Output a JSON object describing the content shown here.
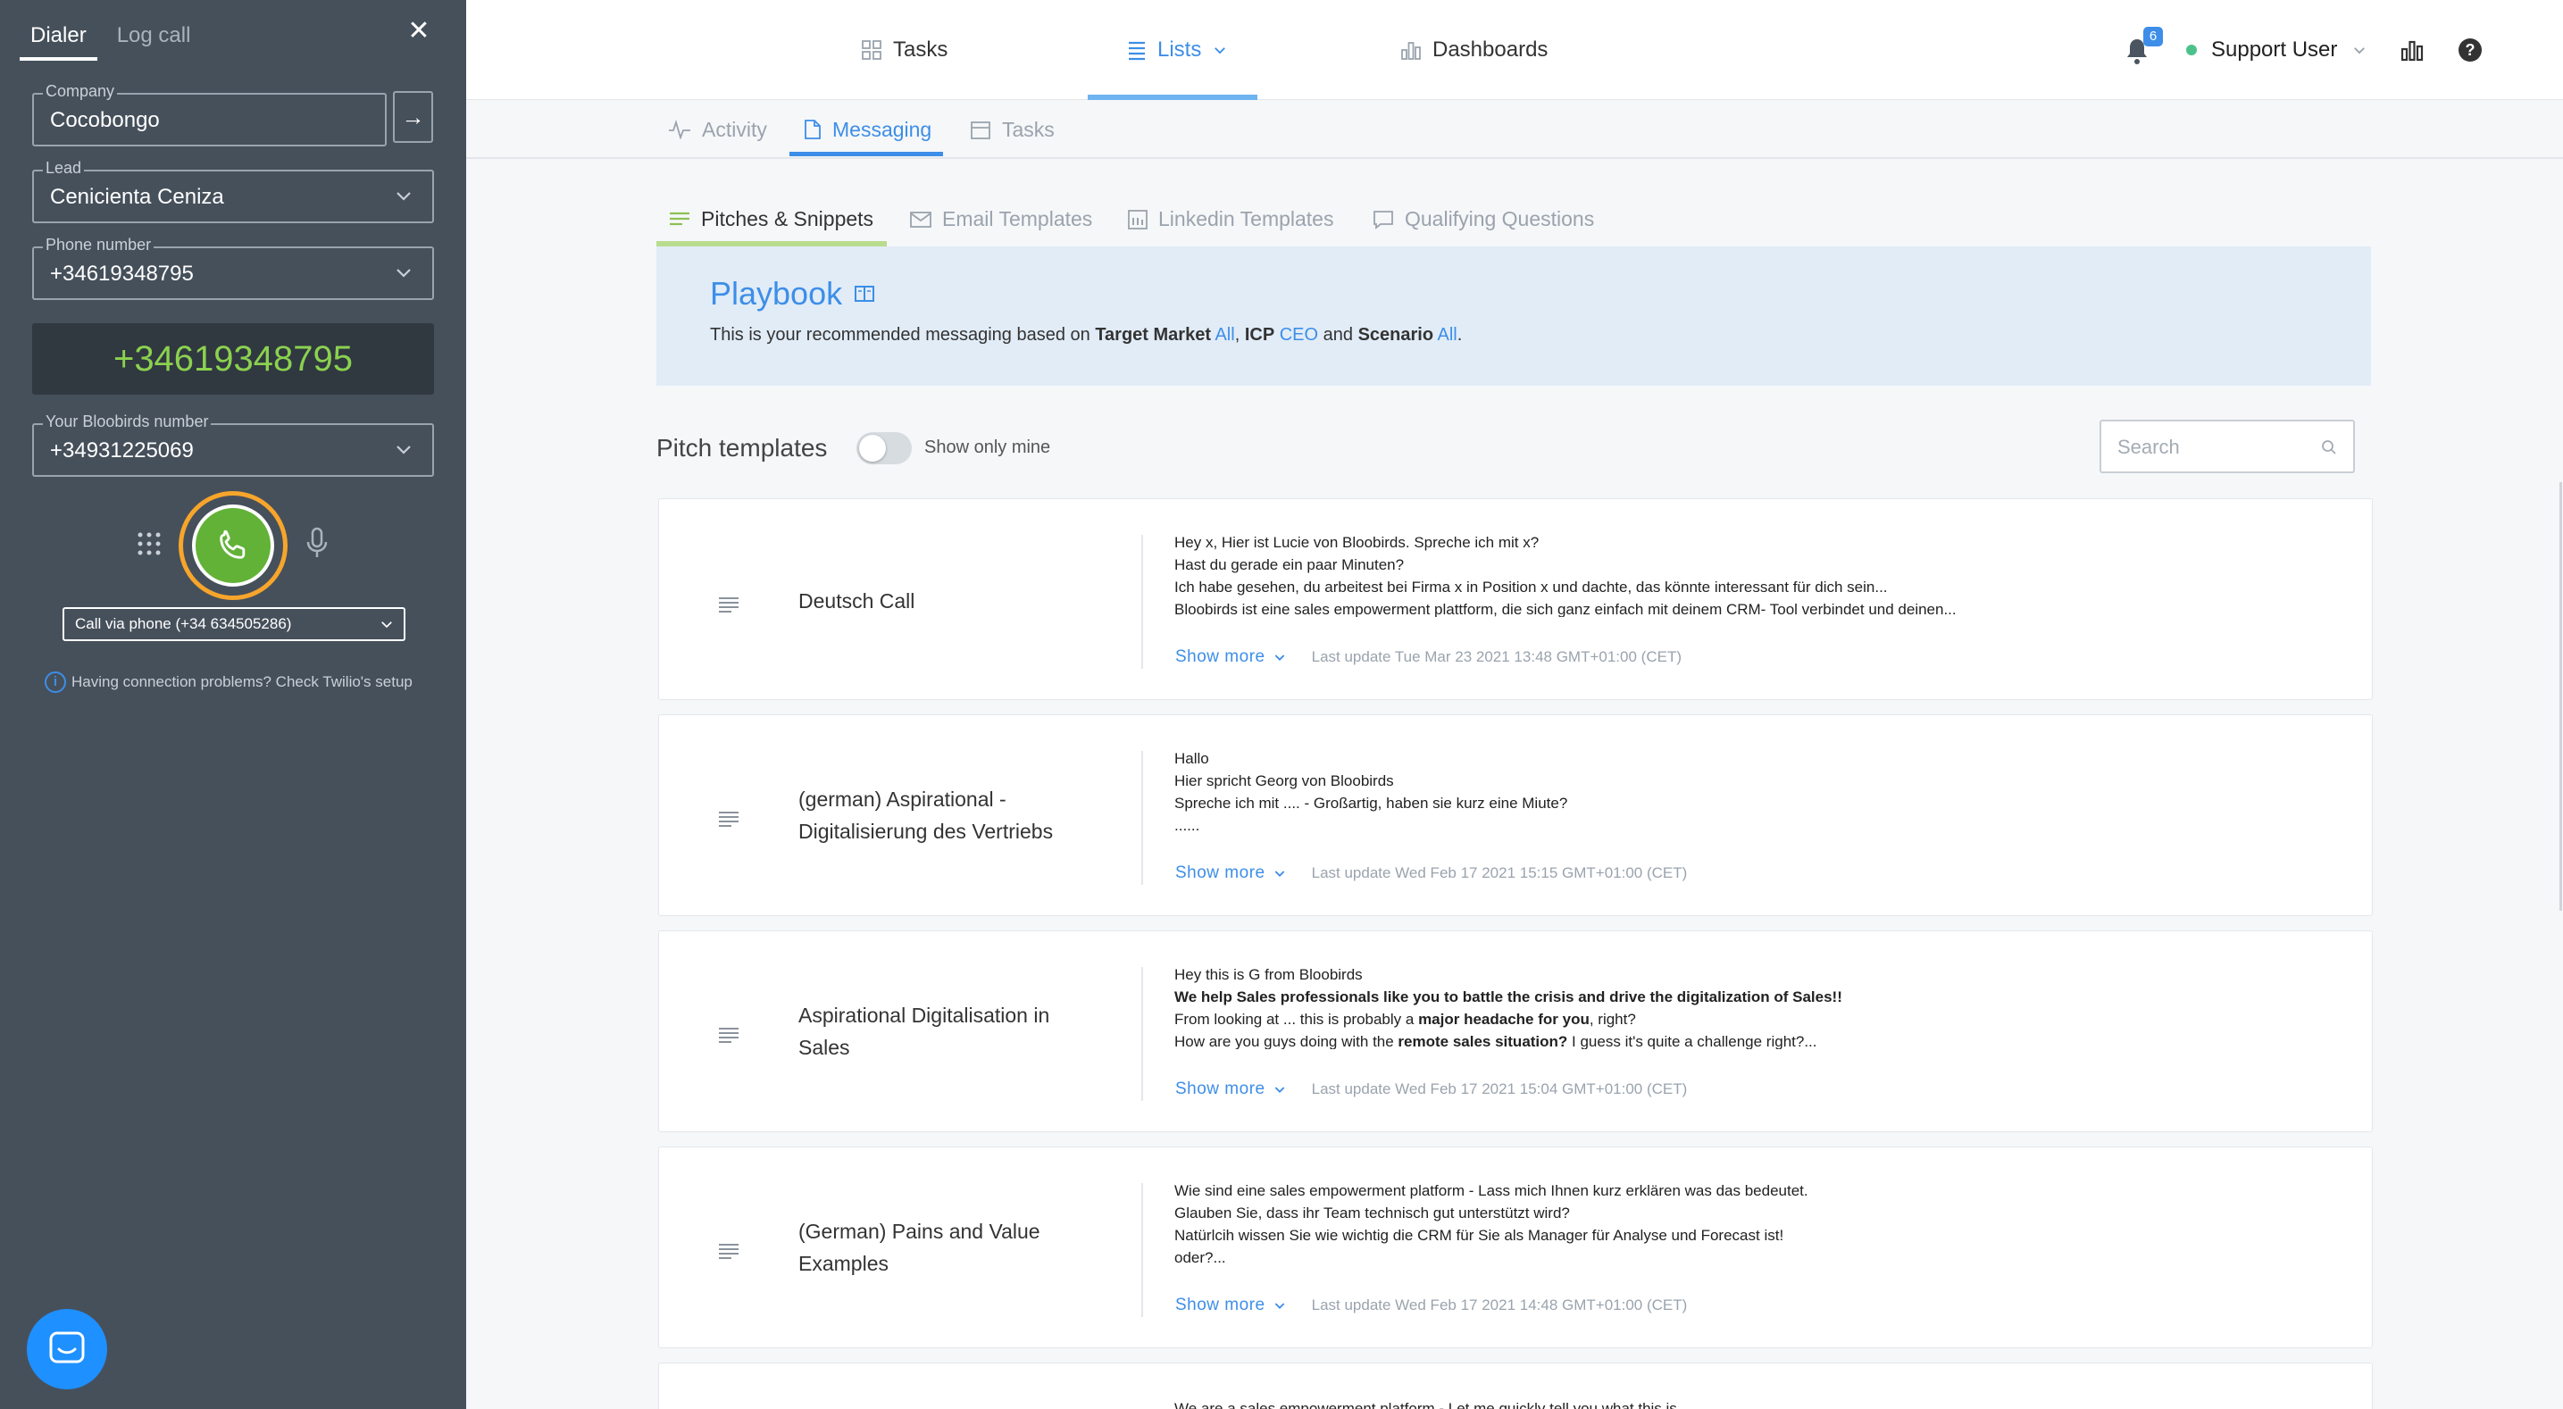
{
  "dialer": {
    "tabs": [
      "Dialer",
      "Log call"
    ],
    "company": {
      "label": "Company",
      "value": "Cocobongo"
    },
    "lead": {
      "label": "Lead",
      "value": "Cenicienta Ceniza"
    },
    "phone": {
      "label": "Phone number",
      "value": "+34619348795"
    },
    "display_number": "+34619348795",
    "bloobirds_number": {
      "label": "Your Bloobirds number",
      "value": "+34931225069"
    },
    "call_via": "Call via phone (+34 634505286)",
    "connection_problems": "Having connection problems? Check Twilio's setup"
  },
  "topnav": {
    "tasks": "Tasks",
    "lists": "Lists",
    "dashboards": "Dashboards",
    "notifications_count": "6",
    "user": "Support User"
  },
  "subnav": {
    "activity": "Activity",
    "messaging": "Messaging",
    "tasks": "Tasks"
  },
  "content_tabs": [
    "Pitches & Snippets",
    "Email Templates",
    "Linkedin Templates",
    "Qualifying Questions"
  ],
  "playbook": {
    "title": "Playbook",
    "desc_prefix": "This is your recommended messaging based on ",
    "target_market_label": "Target Market",
    "target_market_value": "All",
    "icp_label": "ICP",
    "icp_value": "CEO",
    "and_word": "and",
    "scenario_label": "Scenario",
    "scenario_value": "All"
  },
  "pitch": {
    "title": "Pitch templates",
    "show_only_mine": "Show only mine",
    "search_placeholder": "Search"
  },
  "cards": [
    {
      "name": "Deutsch Call",
      "lines": [
        "Hey x,  Hier ist Lucie von Bloobirds. Spreche ich mit x?",
        "Hast du gerade ein paar Minuten?",
        "Ich habe gesehen, du arbeitest bei Firma x in Position x und dachte, das könnte interessant für dich sein...",
        "Bloobirds ist eine sales empowerment plattform, die sich ganz einfach mit deinem CRM- Tool verbindet und deinen..."
      ],
      "show_more": "Show more",
      "last_update": "Last update Tue Mar 23 2021 13:48 GMT+01:00 (CET)"
    },
    {
      "name": "(german) Aspirational - Digitalisierung des Vertriebs",
      "lines": [
        "Hallo",
        "Hier spricht Georg von Bloobirds",
        "Spreche ich mit .... - Großartig, haben sie kurz eine Miute?",
        "......"
      ],
      "show_more": "Show more",
      "last_update": "Last update Wed Feb 17 2021 15:15 GMT+01:00 (CET)"
    },
    {
      "name": "Aspirational Digitalisation in Sales",
      "line1": "Hey this is G from Bloobirds",
      "line2": "We help Sales professionals like you to battle the crisis and drive the digitalization of Sales!!",
      "line3_a": "From looking at ... this is probably a ",
      "line3_b": "major headache for you",
      "line3_c": ", right?",
      "line4_a": "How are you guys doing with the ",
      "line4_b": "remote sales situation?",
      "line4_c": " I guess it's quite a challenge right?...",
      "show_more": "Show more",
      "last_update": "Last update Wed Feb 17 2021 15:04 GMT+01:00 (CET)"
    },
    {
      "name": "(German) Pains and Value Examples",
      "lines": [
        "Wie sind eine sales empowerment platform - Lass mich Ihnen kurz erklären was das bedeutet.",
        "Glauben Sie, dass ihr Team technisch gut unterstützt wird?",
        "Natürlcih wissen Sie wie wichtig die CRM für Sie als Manager für Analyse und Forecast ist!",
        "oder?..."
      ],
      "show_more": "Show more",
      "last_update": "Last update Wed Feb 17 2021 14:48 GMT+01:00 (CET)"
    },
    {
      "name": "",
      "lines": [
        "We are a sales empowerment platform - Let me quickly tell you what this is"
      ]
    }
  ],
  "colors": {
    "dialer_bg": "#46505b",
    "accent_blue": "#3d8ee8",
    "call_green": "#63b238",
    "call_ring": "#f7a52b",
    "number_green": "#8bd14f"
  }
}
